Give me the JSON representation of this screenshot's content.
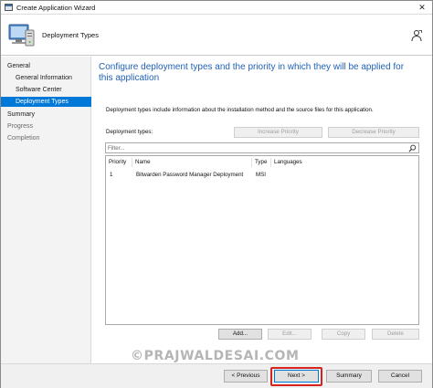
{
  "window": {
    "title": "Create Application Wizard",
    "close_glyph": "✕"
  },
  "header": {
    "title": "Deployment Types",
    "icon": "wizard-computer-icon",
    "help_icon": "help-person-icon"
  },
  "nav": {
    "items": [
      {
        "label": "General",
        "level": 0,
        "state": "normal"
      },
      {
        "label": "General Information",
        "level": 1,
        "state": "normal"
      },
      {
        "label": "Software Center",
        "level": 1,
        "state": "normal"
      },
      {
        "label": "Deployment Types",
        "level": 1,
        "state": "active"
      },
      {
        "label": "Summary",
        "level": 0,
        "state": "normal"
      },
      {
        "label": "Progress",
        "level": 0,
        "state": "dim"
      },
      {
        "label": "Completion",
        "level": 0,
        "state": "dim"
      }
    ]
  },
  "main": {
    "heading": "Configure deployment types and the priority in which they will be applied for this application",
    "description": "Deployment types include information about the installation method and the source files for this application.",
    "deployment_types_label": "Deployment types:",
    "increase_priority": "Increase Priority",
    "decrease_priority": "Decrease Priority",
    "filter_placeholder": "Filter...",
    "columns": [
      "Priority",
      "Name",
      "Type",
      "Languages"
    ],
    "rows": [
      {
        "priority": "1",
        "name": "Bitwarden Password Manager Deployment",
        "type": "MSI",
        "languages": ""
      }
    ],
    "add_button": "Add...",
    "edit_button": "Edit...",
    "copy_button": "Copy",
    "delete_button": "Delete"
  },
  "watermark": "©PRAJWALDESAI.COM",
  "footer": {
    "previous": "< Previous",
    "next": "Next >",
    "summary": "Summary",
    "cancel": "Cancel"
  },
  "colors": {
    "accent": "#0078d7",
    "heading": "#2161b6",
    "highlight": "#d6241d"
  }
}
